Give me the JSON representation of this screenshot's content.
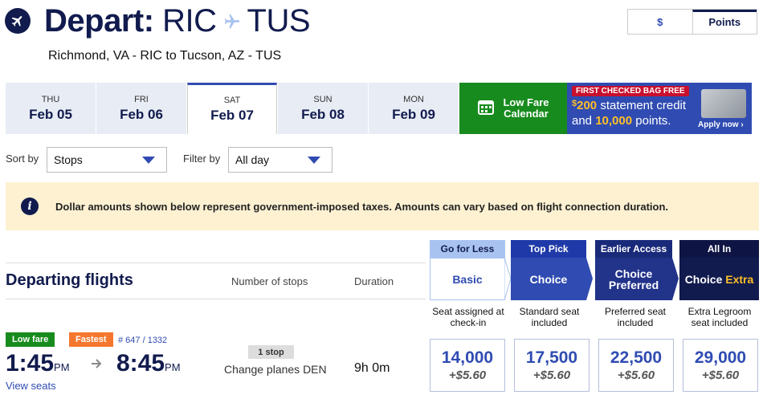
{
  "header": {
    "depart_label": "Depart:",
    "origin": "RIC",
    "destination": "TUS",
    "subtitle": "Richmond, VA - RIC to Tucson, AZ - TUS"
  },
  "currency_toggle": {
    "dollars": "$",
    "points": "Points",
    "selected": "Points"
  },
  "date_tabs": [
    {
      "dow": "THU",
      "date": "Feb 05"
    },
    {
      "dow": "FRI",
      "date": "Feb 06"
    },
    {
      "dow": "SAT",
      "date": "Feb 07",
      "selected": true
    },
    {
      "dow": "SUN",
      "date": "Feb 08"
    },
    {
      "dow": "MON",
      "date": "Feb 09"
    }
  ],
  "low_fare": {
    "line1": "Low Fare",
    "line2": "Calendar"
  },
  "promo": {
    "badge": "FIRST CHECKED BAG FREE",
    "currency": "$",
    "amount": "200",
    "line1_rest": " statement credit",
    "line2_prefix": "and ",
    "points": "10,000",
    "line2_suffix": " points.",
    "apply": "Apply now"
  },
  "sort": {
    "label": "Sort by",
    "value": "Stops"
  },
  "filter": {
    "label": "Filter by",
    "value": "All day"
  },
  "banner": {
    "text": "Dollar amounts shown below represent government-imposed taxes. Amounts can vary based on flight connection duration."
  },
  "list_header": {
    "title": "Departing flights",
    "stops_col": "Number of stops",
    "duration_col": "Duration"
  },
  "fares": [
    {
      "tag": "Go for Less",
      "name": "Basic",
      "desc": "Seat assigned at check-in",
      "tag_bg": "#a9c3f0",
      "tag_fg": "#111b4e",
      "main_bg": "#ffffff",
      "main_fg": "#304cb2"
    },
    {
      "tag": "Top Pick",
      "name": "Choice",
      "desc": "Standard seat included",
      "tag_bg": "#1f3aa8",
      "tag_fg": "#ffffff",
      "main_bg": "#304cb2",
      "main_fg": "#ffffff"
    },
    {
      "tag": "Earlier Access",
      "name": "Choice Preferred",
      "desc": "Preferred seat included",
      "tag_bg": "#1a2a7a",
      "tag_fg": "#ffffff",
      "main_bg": "#22338a",
      "main_fg": "#ffffff"
    },
    {
      "tag": "All In",
      "name_a": "Choice",
      "name_b": "Extra",
      "desc": "Extra Legroom seat included",
      "tag_bg": "#0e1544",
      "tag_fg": "#ffffff",
      "main_bg": "#111b4e",
      "main_fg": "#ffffff",
      "accent": "#ffbf27"
    }
  ],
  "flight": {
    "badges": [
      {
        "text": "Low fare",
        "color": "#188b1e"
      },
      {
        "text": "Fastest",
        "color": "#f5772f"
      }
    ],
    "flight_numbers": "# 647 / 1332",
    "depart_time": "1:45",
    "depart_ampm": "PM",
    "arrive_time": "8:45",
    "arrive_ampm": "PM",
    "stops": "1 stop",
    "change": "Change planes DEN",
    "duration": "9h 0m",
    "view_seats": "View seats",
    "prices": [
      {
        "points": "14,000",
        "tax": "+$5.60"
      },
      {
        "points": "17,500",
        "tax": "+$5.60"
      },
      {
        "points": "22,500",
        "tax": "+$5.60"
      },
      {
        "points": "29,000",
        "tax": "+$5.60"
      }
    ]
  }
}
